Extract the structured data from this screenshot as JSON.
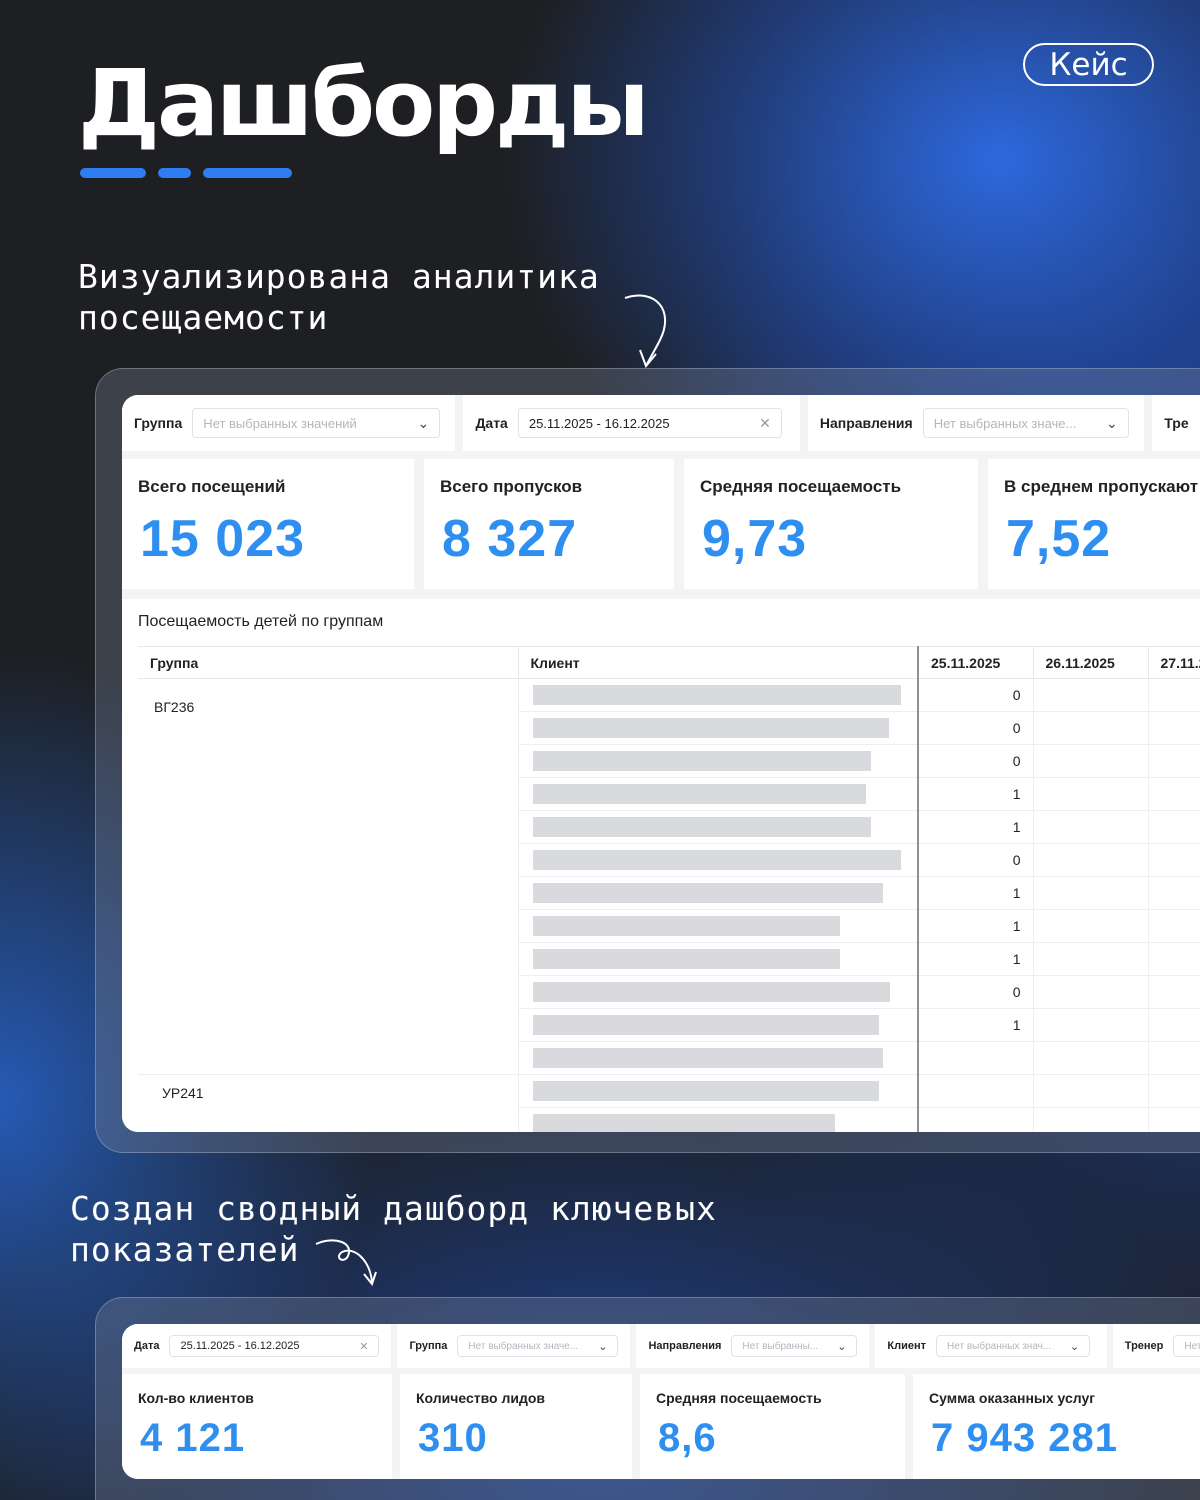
{
  "title": "Дашборды",
  "badge": "Кейс",
  "caption1": [
    "Визуализирована аналитика",
    "посещаемости"
  ],
  "caption2": [
    "Создан сводный дашборд ключевых",
    "показателей"
  ],
  "dashboard1": {
    "filters": [
      {
        "label": "Группа",
        "value": "",
        "placeholder": "Нет выбранных значений",
        "icon": "chevron-down-icon"
      },
      {
        "label": "Дата",
        "value": "25.11.2025 - 16.12.2025",
        "placeholder": "",
        "icon": "close-icon"
      },
      {
        "label": "Направления",
        "value": "",
        "placeholder": "Нет выбранных значе...",
        "icon": "chevron-down-icon"
      },
      {
        "label": "Тре",
        "value": "",
        "placeholder": "",
        "icon": ""
      }
    ],
    "kpis": [
      {
        "title": "Всего посещений",
        "value": "15 023"
      },
      {
        "title": "Всего пропусков",
        "value": "8 327"
      },
      {
        "title": "Средняя посещаемость",
        "value": "9,73"
      },
      {
        "title": "В среднем пропускают",
        "value": "7,52"
      }
    ],
    "table": {
      "title": "Посещаемость детей по группам",
      "headers": [
        "Группа",
        "Клиент",
        "25.11.2025",
        "26.11.2025",
        "27.11.2"
      ],
      "groups": [
        {
          "name": "ВГ236",
          "rows": [
            "0",
            "0",
            "0",
            "1",
            "1",
            "0",
            "1",
            "1",
            "1",
            "0",
            "1",
            ""
          ]
        },
        {
          "name": "УР241",
          "rows": [
            "",
            ""
          ]
        }
      ]
    }
  },
  "dashboard2": {
    "filters": [
      {
        "label": "Дата",
        "value": "25.11.2025 - 16.12.2025",
        "placeholder": "",
        "icon": "close-icon"
      },
      {
        "label": "Группа",
        "value": "",
        "placeholder": "Нет выбранных значе...",
        "icon": "chevron-down-icon"
      },
      {
        "label": "Направления",
        "value": "",
        "placeholder": "Нет выбранны...",
        "icon": "chevron-down-icon"
      },
      {
        "label": "Клиент",
        "value": "",
        "placeholder": "Нет выбранных знач...",
        "icon": "chevron-down-icon"
      },
      {
        "label": "Тренер",
        "value": "",
        "placeholder": "Нет",
        "icon": ""
      }
    ],
    "kpis": [
      {
        "title": "Кол-во клиентов",
        "value": "4 121"
      },
      {
        "title": "Количество лидов",
        "value": "310"
      },
      {
        "title": "Средняя посещаемость",
        "value": "8,6"
      },
      {
        "title": "Сумма оказанных услуг",
        "value": "7 943 281"
      }
    ]
  }
}
